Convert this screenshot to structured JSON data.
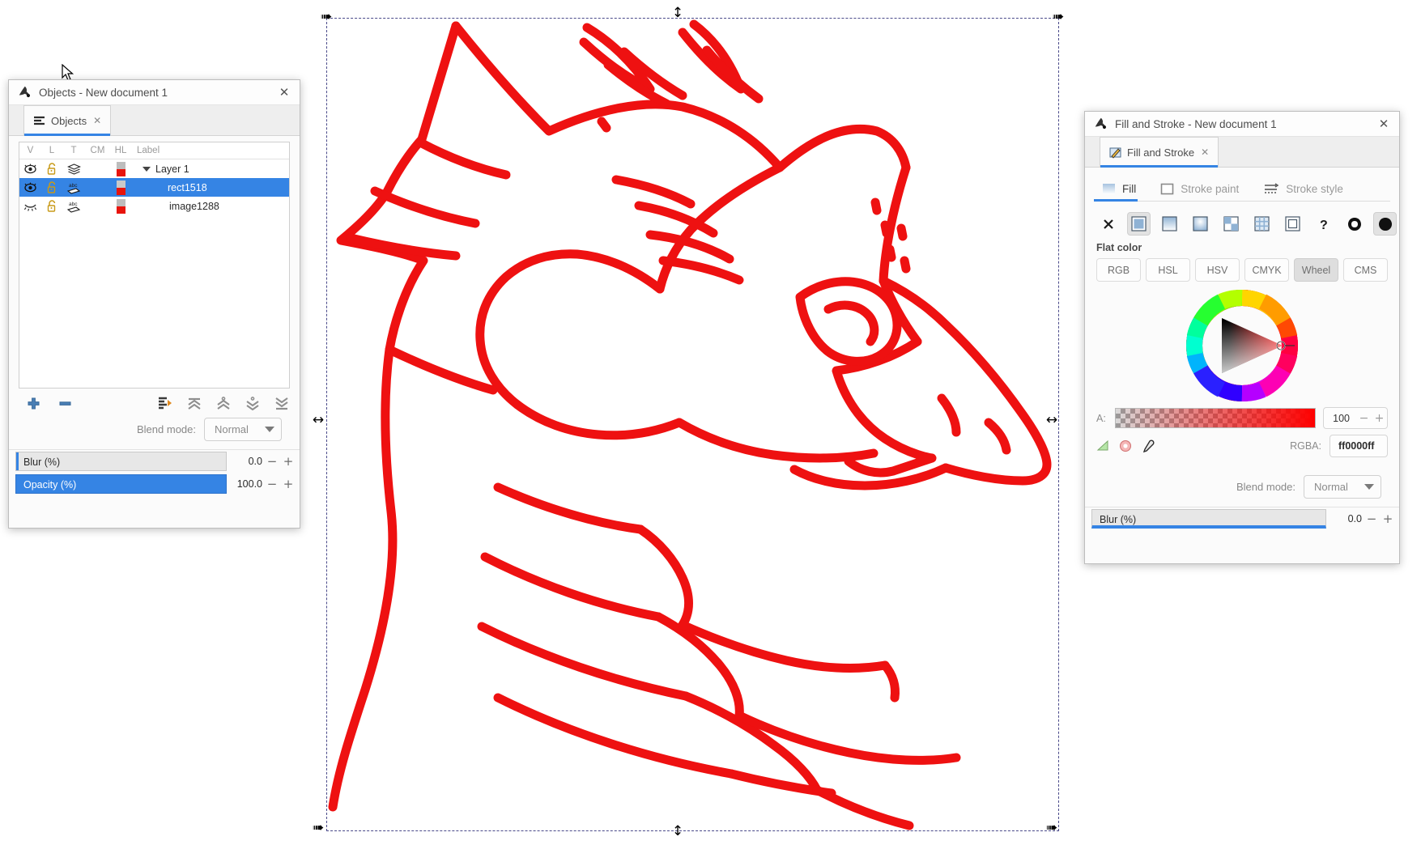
{
  "canvas": {
    "selection": {
      "handle_icons": [
        "arrow-nw",
        "arrow-v-top",
        "arrow-ne",
        "arrow-h-left",
        "arrow-h-right",
        "arrow-sw",
        "arrow-v-bottom",
        "arrow-se"
      ]
    },
    "artwork_name": "dragon-head-line-art",
    "artwork_color": "#ee1111"
  },
  "objects_dialog": {
    "title": "Objects - New document 1",
    "close_label": "✕",
    "tab": {
      "label": "Objects",
      "close": "✕",
      "icon": "objects-icon"
    },
    "columns": [
      "V",
      "L",
      "T",
      "CM",
      "HL",
      "Label"
    ],
    "rows": [
      {
        "label": "Layer 1",
        "visible": true,
        "locked": false,
        "type_icon": "layers-icon",
        "hl_color": "#e8140c",
        "selected": false,
        "expander": true,
        "indent": 0
      },
      {
        "label": "rect1518",
        "visible": true,
        "locked": false,
        "type_icon": "abc-label-icon",
        "hl_color": "#e8140c",
        "selected": true,
        "expander": false,
        "indent": 1
      },
      {
        "label": "image1288",
        "visible": false,
        "locked": false,
        "type_icon": "abc-label-icon",
        "hl_color": "#e8140c",
        "selected": false,
        "expander": false,
        "indent": 1
      }
    ],
    "toolbar": [
      {
        "name": "add-object-button",
        "icon": "plus-icon"
      },
      {
        "name": "remove-object-button",
        "icon": "minus-icon"
      },
      {
        "name": "move-to-layer-button",
        "icon": "move-to-layer-icon"
      },
      {
        "name": "raise-to-top-button",
        "icon": "raise-to-top-icon"
      },
      {
        "name": "raise-button",
        "icon": "raise-icon"
      },
      {
        "name": "lower-button",
        "icon": "lower-icon"
      },
      {
        "name": "lower-to-bottom-button",
        "icon": "lower-to-bottom-icon"
      }
    ],
    "blend_mode": {
      "label": "Blend mode:",
      "value": "Normal"
    },
    "sliders": [
      {
        "name": "Blur (%)",
        "value": "0.0",
        "fill_pct": 0,
        "minus": "−",
        "plus": "+"
      },
      {
        "name": "Opacity (%)",
        "value": "100.0",
        "fill_pct": 100,
        "minus": "−",
        "plus": "+"
      }
    ]
  },
  "fill_stroke_dialog": {
    "title": "Fill and Stroke - New document 1",
    "close_label": "✕",
    "tab": {
      "label": "Fill and Stroke",
      "close": "✕",
      "icon": "fill-stroke-icon"
    },
    "subtabs": [
      {
        "label": "Fill",
        "icon": "fill-swatch-icon",
        "active": true
      },
      {
        "label": "Stroke paint",
        "icon": "stroke-paint-icon",
        "active": false
      },
      {
        "label": "Stroke style",
        "icon": "stroke-style-icon",
        "active": false
      }
    ],
    "paint_buttons": [
      {
        "name": "no-paint-button",
        "icon": "x-icon",
        "selected": false
      },
      {
        "name": "flat-color-button",
        "icon": "flat-color-icon",
        "selected": true
      },
      {
        "name": "linear-gradient-button",
        "icon": "linear-gradient-icon",
        "selected": false
      },
      {
        "name": "radial-gradient-button",
        "icon": "radial-gradient-icon",
        "selected": false
      },
      {
        "name": "pattern-button",
        "icon": "pattern-icon",
        "selected": false
      },
      {
        "name": "mesh-gradient-button",
        "icon": "mesh-gradient-icon",
        "selected": false
      },
      {
        "name": "swatch-button",
        "icon": "swatch-icon",
        "selected": false
      },
      {
        "name": "unknown-paint-button",
        "icon": "question-mark-icon",
        "selected": false
      },
      {
        "name": "fill-rule-evenodd-button",
        "icon": "fill-rule-evenodd-icon",
        "selected": false
      },
      {
        "name": "fill-rule-nonzero-button",
        "icon": "fill-rule-nonzero-icon",
        "selected": true
      }
    ],
    "flat_color_label": "Flat color",
    "color_modes": [
      {
        "label": "RGB",
        "selected": false
      },
      {
        "label": "HSL",
        "selected": false
      },
      {
        "label": "HSV",
        "selected": false
      },
      {
        "label": "CMYK",
        "selected": false
      },
      {
        "label": "Wheel",
        "selected": true
      },
      {
        "label": "CMS",
        "selected": false
      }
    ],
    "color_wheel": {
      "name": "color-wheel",
      "selected_hex": "#ff0000"
    },
    "alpha": {
      "label": "A:",
      "value": "100",
      "minus": "−",
      "plus": "+",
      "color": "#ff0000"
    },
    "bottom_icons": [
      {
        "name": "pick-alpha-icon"
      },
      {
        "name": "assign-alpha-icon"
      },
      {
        "name": "eyedropper-icon"
      }
    ],
    "rgba": {
      "label": "RGBA:",
      "value": "ff0000ff"
    },
    "blend_mode": {
      "label": "Blend mode:",
      "value": "Normal"
    },
    "blur": {
      "name": "Blur (%)",
      "value": "0.0",
      "fill_pct": 100,
      "minus": "−",
      "plus": "+"
    }
  }
}
